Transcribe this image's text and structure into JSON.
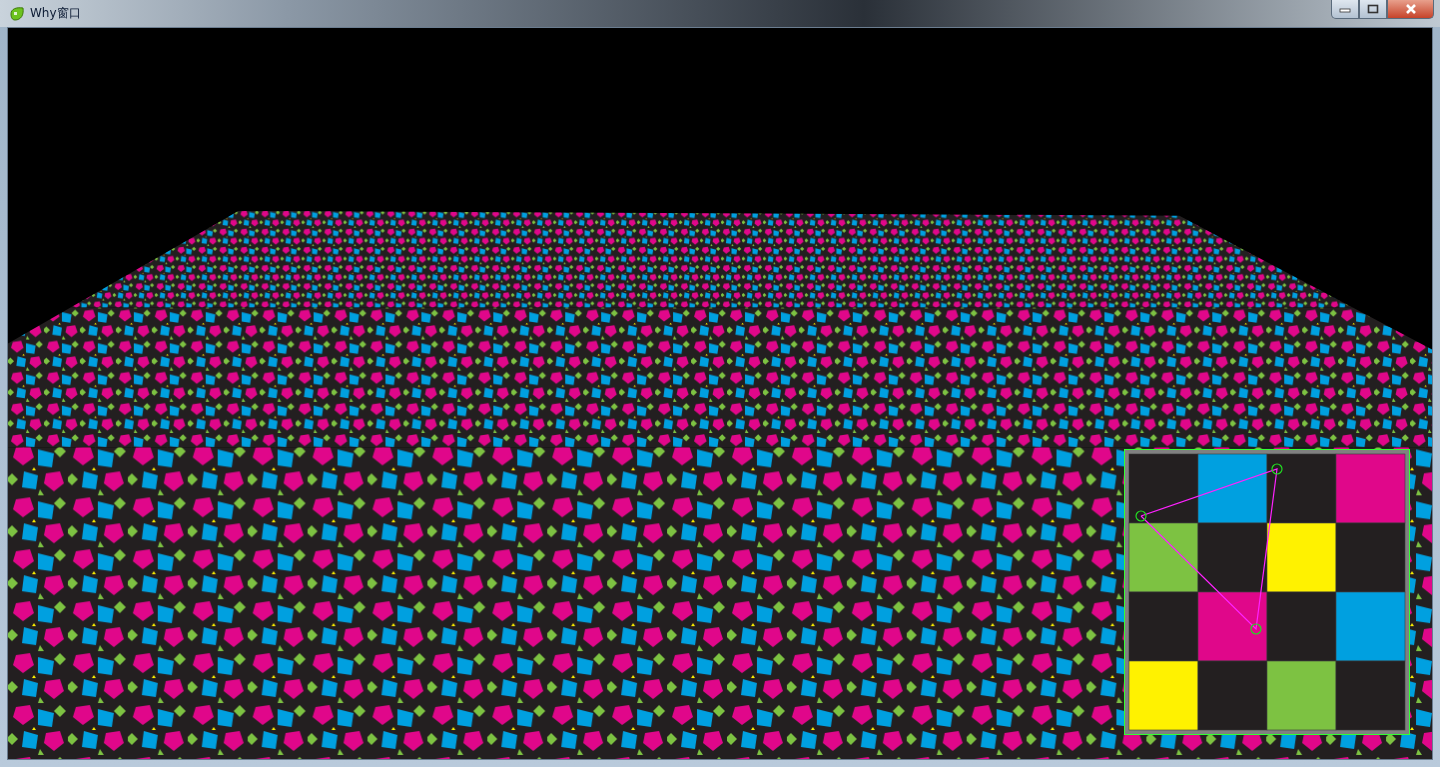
{
  "window": {
    "title": "Why窗口"
  }
}
